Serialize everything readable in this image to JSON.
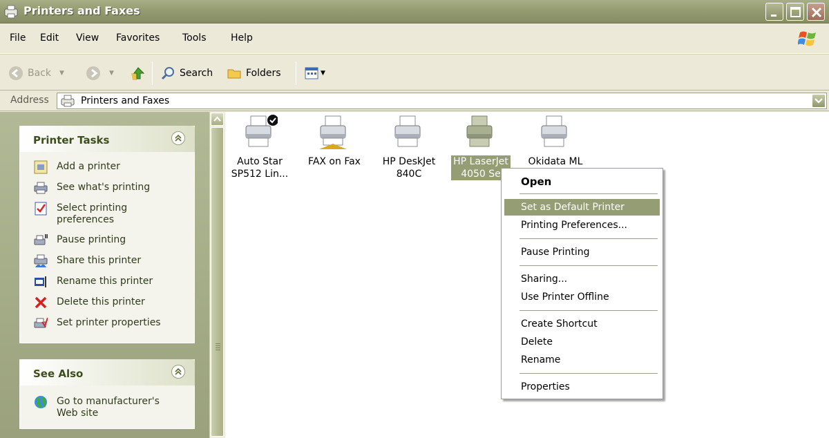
{
  "window": {
    "title": "Printers and Faxes"
  },
  "menubar": {
    "items": [
      "File",
      "Edit",
      "View",
      "Favorites",
      "Tools",
      "Help"
    ]
  },
  "toolbar": {
    "back": "Back",
    "search": "Search",
    "folders": "Folders"
  },
  "address": {
    "label": "Address",
    "value": "Printers and Faxes"
  },
  "printer_tasks": {
    "title": "Printer Tasks",
    "items": [
      {
        "label": "Add a printer",
        "icon": "add-printer-icon"
      },
      {
        "label": "See what's printing",
        "icon": "printer-queue-icon"
      },
      {
        "label": "Select printing\npreferences",
        "icon": "preferences-icon"
      },
      {
        "label": "Pause printing",
        "icon": "pause-printer-icon"
      },
      {
        "label": "Share this printer",
        "icon": "share-printer-icon"
      },
      {
        "label": "Rename this printer",
        "icon": "rename-icon"
      },
      {
        "label": "Delete this printer",
        "icon": "delete-icon"
      },
      {
        "label": "Set printer properties",
        "icon": "properties-icon"
      }
    ]
  },
  "see_also": {
    "title": "See Also",
    "items": [
      {
        "label": "Go to manufacturer's\nWeb site",
        "icon": "globe-icon"
      }
    ]
  },
  "printers": [
    {
      "name": "Auto Star\nSP512 Lin...",
      "default": true,
      "selected": false
    },
    {
      "name": "FAX on Fax",
      "fax": true,
      "selected": false
    },
    {
      "name": "HP DeskJet\n840C",
      "selected": false
    },
    {
      "name": "HP LaserJet\n4050 Se",
      "selected": true
    },
    {
      "name": "Okidata ML",
      "selected": false
    }
  ],
  "context_menu": {
    "items": [
      {
        "label": "Open",
        "bold": true
      },
      {
        "label": "Set as Default Printer",
        "highlighted": true
      },
      {
        "label": "Printing Preferences..."
      },
      {
        "label": "Pause Printing"
      },
      {
        "label": "Sharing..."
      },
      {
        "label": "Use Printer Offline"
      },
      {
        "label": "Create Shortcut"
      },
      {
        "label": "Delete"
      },
      {
        "label": "Rename"
      },
      {
        "label": "Properties"
      }
    ]
  },
  "colors": {
    "selection": "#959d75",
    "panel": "#b2b996",
    "task_title": "#3d4d1e"
  }
}
